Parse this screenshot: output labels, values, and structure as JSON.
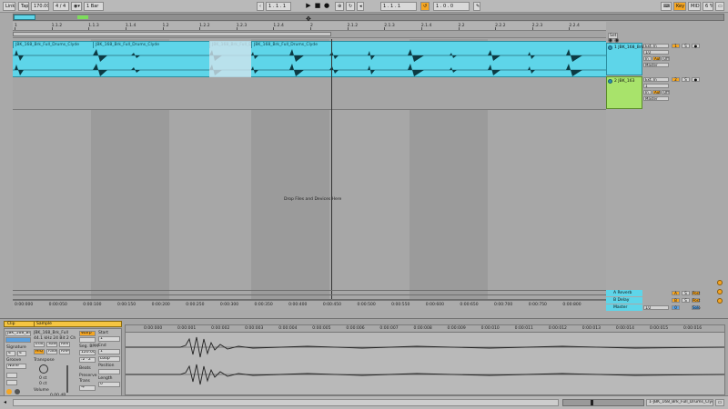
{
  "transport": {
    "link": "Link",
    "tap": "Tap",
    "tempo": "170.00",
    "signature": "4 / 4",
    "quantize": "1 Bar",
    "position": "1 .   1 .   1",
    "loop_start": "1 .   1 .   1",
    "loop_length": "1 .   0 .   0",
    "key": "Key",
    "midi": "MIDI",
    "cpu": "6 %",
    "status_box_1": "",
    "status_box_2": ""
  },
  "ruler": {
    "top_ticks": [
      "1",
      "1.1.2",
      "1.1.3",
      "1.1.4",
      "1.2",
      "1.2.2",
      "1.2.3",
      "1.2.4",
      "2",
      "2.1.2",
      "2.1.3",
      "2.1.4",
      "2.2",
      "2.2.2",
      "2.2.3",
      "2.2.4"
    ],
    "bottom_ticks": [
      "0:00:000",
      "0:00:050",
      "0:00:100",
      "0:00:150",
      "0:00:200",
      "0:00:250",
      "0:00:300",
      "0:00:350",
      "0:00:400",
      "0:00:450",
      "0:00:500",
      "0:00:550",
      "0:00:600",
      "0:00:650",
      "0:00:700",
      "0:00:750",
      "0:00:800"
    ]
  },
  "arrangement": {
    "clips": [
      "JBK_168_Brk_Full_Drums_Clyde",
      "JBK_168_Brk_Full_Drums_Clyde",
      "JBK_168_Brk_Full_Drums_Clyde",
      "JBK_168_Brk_Full_Drums_Clyde"
    ],
    "drop_message": "Drop Files and Devices Here"
  },
  "mixer": {
    "set_label": "Set",
    "tracks": [
      {
        "name": "1 JBK_168_Brk",
        "input_type": "Ext. In",
        "channel": "1/2",
        "monitor_in": "In",
        "monitor_auto": "Auto",
        "monitor_off": "Off",
        "output": "Master",
        "number": "1",
        "solo": "S"
      },
      {
        "name": "2 JBK_163",
        "input_type": "Ext. In",
        "channel": "1",
        "monitor_in": "In",
        "monitor_auto": "Auto",
        "monitor_off": "Off",
        "output": "Master",
        "number": "2",
        "solo": "S"
      }
    ],
    "returns": [
      {
        "name": "A Reverb",
        "letter": "A",
        "post": "Post"
      },
      {
        "name": "B Delay",
        "letter": "B",
        "post": "Post"
      },
      {
        "name": "Master",
        "letter": "0",
        "post": "Solo",
        "cue": "1/2"
      }
    ]
  },
  "detail": {
    "clip_tab": "Clip",
    "sample_tab": "Sample",
    "clip_name": "JBK_168_Br",
    "sample_name": "JBK_168_Brk_Full",
    "sample_info": "44.1 kHz 24 Bit 2 Ch",
    "edit": "Edit",
    "save": "Save",
    "rev": "Rev",
    "hiq": "HiQ",
    "fade": "Fade",
    "ram": "RAM",
    "warp": "Warp",
    "seg_bpm_label": "Seg. BPM",
    "seg_bpm": "120.00",
    "signature_label": "Signature",
    "sig_num": "4",
    "sig_den": "4",
    "groove_label": "Groove",
    "groove_value": "None",
    "transpose_label": "Transpose",
    "transpose_value": "0 st",
    "detune": "0 ct",
    "volume_label": "Volume",
    "volume_value": "0.00 dB",
    "start_label": "Start",
    "end_label": "End",
    "loop_label": "Loop",
    "position_label": "Position",
    "length_label": "Length",
    "beats_label": "Beats",
    "preserve_label": "Preserve",
    "trans_label": "Trans",
    "start_value": "1",
    "end_value": "1",
    "length_value": "0",
    "wave_ticks": [
      "0:00:000",
      "0:00:001",
      "0:00:002",
      "0:00:003",
      "0:00:004",
      "0:00:005",
      "0:00:006",
      "0:00:007",
      "0:00:008",
      "0:00:009",
      "0:00:010",
      "0:00:011",
      "0:00:012",
      "0:00:013",
      "0:00:014",
      "0:00:015",
      "0:00:016"
    ]
  },
  "bottom": {
    "clip_label": "1-JBK_168_Brk_Full_Drums_Clyde"
  }
}
